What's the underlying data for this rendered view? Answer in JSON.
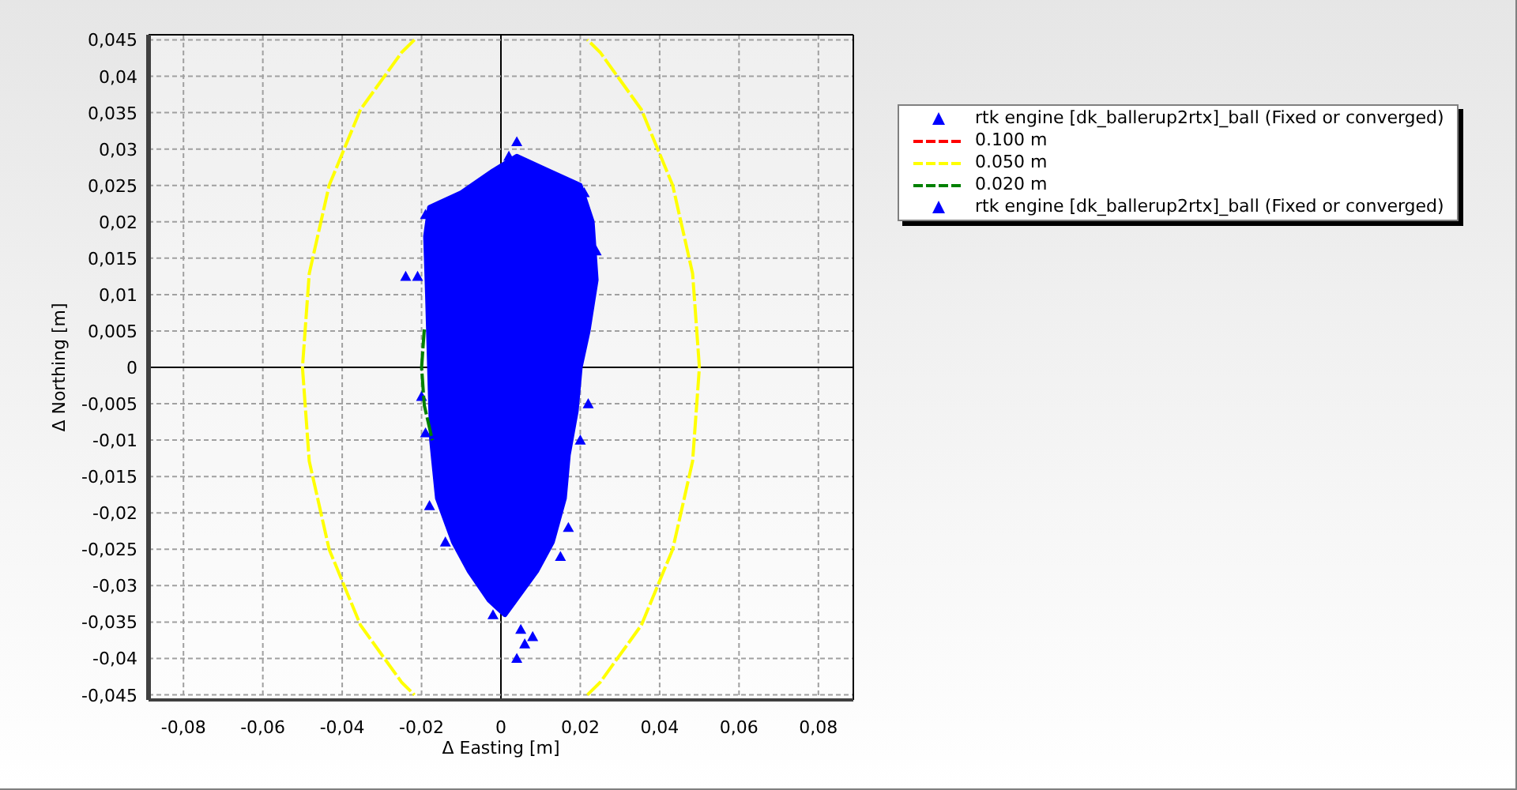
{
  "chart": {
    "chart_data": {
      "type": "scatter",
      "grid": true,
      "xlabel": "Δ Easting [m]",
      "ylabel": "Δ Northing [m]",
      "xlim": [
        -0.0888,
        0.0888
      ],
      "ylim": [
        -0.0457,
        0.0457
      ],
      "xticks": [
        {
          "value": -0.08,
          "label": "-0,08"
        },
        {
          "value": -0.06,
          "label": "-0,06"
        },
        {
          "value": -0.04,
          "label": "-0,04"
        },
        {
          "value": -0.02,
          "label": "-0,02"
        },
        {
          "value": 0,
          "label": "0"
        },
        {
          "value": 0.02,
          "label": "0,02"
        },
        {
          "value": 0.04,
          "label": "0,04"
        },
        {
          "value": 0.06,
          "label": "0,06"
        },
        {
          "value": 0.08,
          "label": "0,08"
        }
      ],
      "yticks": [
        {
          "value": 0.045,
          "label": "0,045"
        },
        {
          "value": 0.04,
          "label": "0,04"
        },
        {
          "value": 0.035,
          "label": "0,035"
        },
        {
          "value": 0.03,
          "label": "0,03"
        },
        {
          "value": 0.025,
          "label": "0,025"
        },
        {
          "value": 0.02,
          "label": "0,02"
        },
        {
          "value": 0.015,
          "label": "0,015"
        },
        {
          "value": 0.01,
          "label": "0,01"
        },
        {
          "value": 0.005,
          "label": "0,005"
        },
        {
          "value": 0,
          "label": "0"
        },
        {
          "value": -0.005,
          "label": "-0,005"
        },
        {
          "value": -0.01,
          "label": "-0,01"
        },
        {
          "value": -0.015,
          "label": "-0,015"
        },
        {
          "value": -0.02,
          "label": "-0,02"
        },
        {
          "value": -0.025,
          "label": "-0,025"
        },
        {
          "value": -0.03,
          "label": "-0,03"
        },
        {
          "value": -0.035,
          "label": "-0,035"
        },
        {
          "value": -0.04,
          "label": "-0,04"
        },
        {
          "value": -0.045,
          "label": "-0,045"
        }
      ],
      "series": [
        {
          "name": "rtk engine [dk_ballerup2rtx]_ball (Fixed or converged)",
          "type": "scatter",
          "color": "#0000ff",
          "x": [
            -0.024,
            -0.021,
            -0.019,
            0.004,
            0.002,
            0.021,
            0.024,
            0.022,
            0.02,
            -0.02,
            -0.019,
            -0.018,
            -0.014
          ],
          "values": [
            0.0125,
            0.0125,
            0.021,
            0.031,
            0.029,
            0.024,
            0.016,
            -0.005,
            -0.01,
            -0.004,
            -0.009,
            -0.019,
            -0.024
          ]
        },
        {
          "name": "0.100 m",
          "type": "line",
          "line_style": "dashed",
          "color": "#ff0000"
        },
        {
          "name": "0.050 m",
          "type": "line",
          "line_style": "dashed",
          "color": "#ffff00",
          "x": [
            0.05,
            0.0483,
            0.0433,
            0.0354,
            0.025,
            0.0218,
            0,
            -0.0218,
            -0.025,
            -0.0354,
            -0.0433,
            -0.0483,
            -0.05,
            -0.0483,
            -0.0433,
            -0.0354,
            -0.025,
            -0.0218,
            0,
            0.0218,
            0.025,
            0.0354,
            0.0433,
            0.0483,
            0.05
          ],
          "values": [
            0,
            0.0129,
            0.025,
            0.0354,
            0.0433,
            0.045,
            null,
            0.045,
            0.0433,
            0.0354,
            0.025,
            0.0129,
            0,
            -0.0129,
            -0.025,
            -0.0354,
            -0.0433,
            -0.045,
            null,
            -0.045,
            -0.0433,
            -0.0354,
            -0.025,
            -0.0129,
            0
          ]
        },
        {
          "name": "0.020 m",
          "type": "line",
          "line_style": "dashed",
          "color": "#008000",
          "x": [
            -0.0193,
            -0.02,
            -0.0193,
            -0.0173
          ],
          "values": [
            0.0052,
            0,
            -0.0052,
            -0.01
          ]
        },
        {
          "name": "rtk engine [dk_ballerup2rtx]_ball (Fixed or converged)",
          "type": "scatter",
          "color": "#0000ff",
          "x": [
            -0.002,
            0.005,
            0.006,
            0.008,
            0.004,
            0.015,
            0.017
          ],
          "values": [
            -0.034,
            -0.036,
            -0.038,
            -0.037,
            -0.04,
            -0.026,
            -0.022
          ]
        }
      ]
    }
  }
}
